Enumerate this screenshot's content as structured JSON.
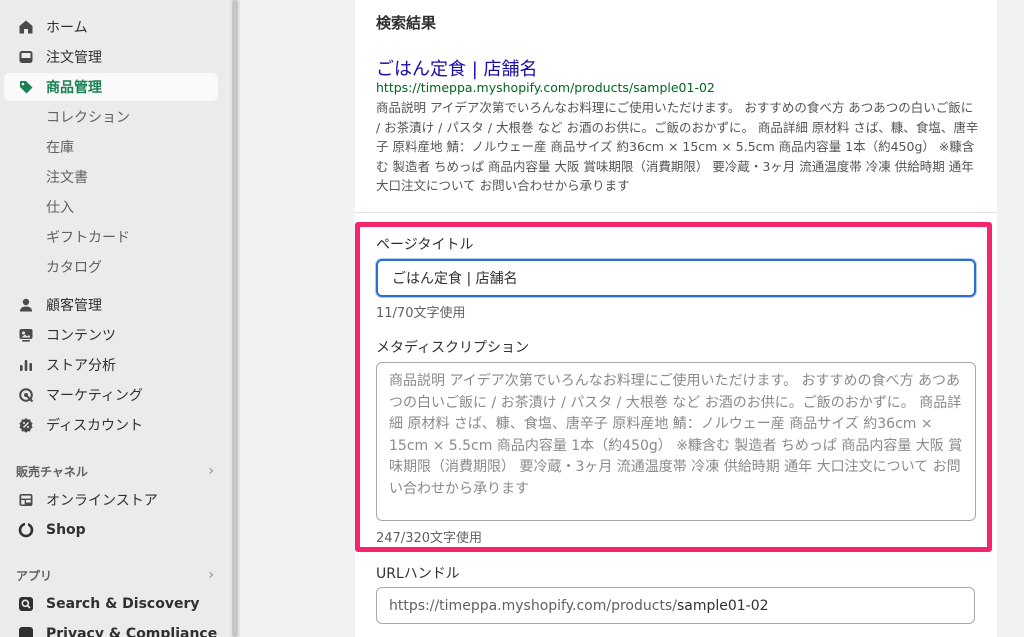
{
  "sidebar": {
    "items": [
      {
        "label": "ホーム"
      },
      {
        "label": "注文管理"
      },
      {
        "label": "商品管理"
      },
      {
        "label": "顧客管理"
      },
      {
        "label": "コンテンツ"
      },
      {
        "label": "ストア分析"
      },
      {
        "label": "マーケティング"
      },
      {
        "label": "ディスカウント"
      }
    ],
    "product_subitems": [
      "コレクション",
      "在庫",
      "注文書",
      "仕入",
      "ギフトカード",
      "カタログ"
    ],
    "sales_channels": {
      "title": "販売チャネル",
      "items": [
        {
          "label": "オンラインストア"
        },
        {
          "label": "Shop"
        }
      ]
    },
    "apps": {
      "title": "アプリ",
      "items": [
        {
          "label": "Search & Discovery"
        },
        {
          "label": "Privacy & Compliance"
        }
      ]
    }
  },
  "preview": {
    "heading": "検索結果",
    "title": "ごはん定食 | 店舗名",
    "url": "https://timeppa.myshopify.com/products/sample01-02",
    "description": "商品説明 アイデア次第でいろんなお料理にご使用いただけます。 おすすめの食べ方 あつあつの白いご飯に / お茶漬け / パスタ / 大根巻 など お酒のお供に。ご飯のおかずに。 商品詳細 原材料 さば、糠、食塩、唐辛子 原料産地 鯖：ノルウェー産 商品サイズ 約36cm × 15cm × 5.5cm 商品内容量 1本（約450g） ※糠含む 製造者 ちめっぱ 商品内容量 大阪 賞味期限（消費期限） 要冷蔵・3ヶ月 流通温度帯 冷凍 供給時期 通年 大口注文について お問い合わせから承ります"
  },
  "form": {
    "page_title_label": "ページタイトル",
    "page_title_value": "ごはん定食 | 店舗名",
    "page_title_counter": "11/70文字使用",
    "meta_label": "メタディスクリプション",
    "meta_value": "商品説明 アイデア次第でいろんなお料理にご使用いただけます。 おすすめの食べ方 あつあつの白いご飯に / お茶漬け / パスタ / 大根巻 など お酒のお供に。ご飯のおかずに。 商品詳細 原材料 さば、糠、食塩、唐辛子 原料産地 鯖：ノルウェー産 商品サイズ 約36cm × 15cm × 5.5cm 商品内容量 1本（約450g） ※糠含む 製造者 ちめっぱ 商品内容量 大阪 賞味期限（消費期限） 要冷蔵・3ヶ月 流通温度帯 冷凍 供給時期 通年 大口注文について お問い合わせから承ります",
    "meta_counter": "247/320文字使用",
    "url_label": "URLハンドル",
    "url_prefix": "https://timeppa.myshopify.com/products/",
    "url_handle": "sample01-02"
  },
  "colors": {
    "active": "#1a7f52",
    "highlight": "#f4256d",
    "link": "#1a0dab",
    "url": "#006621"
  }
}
